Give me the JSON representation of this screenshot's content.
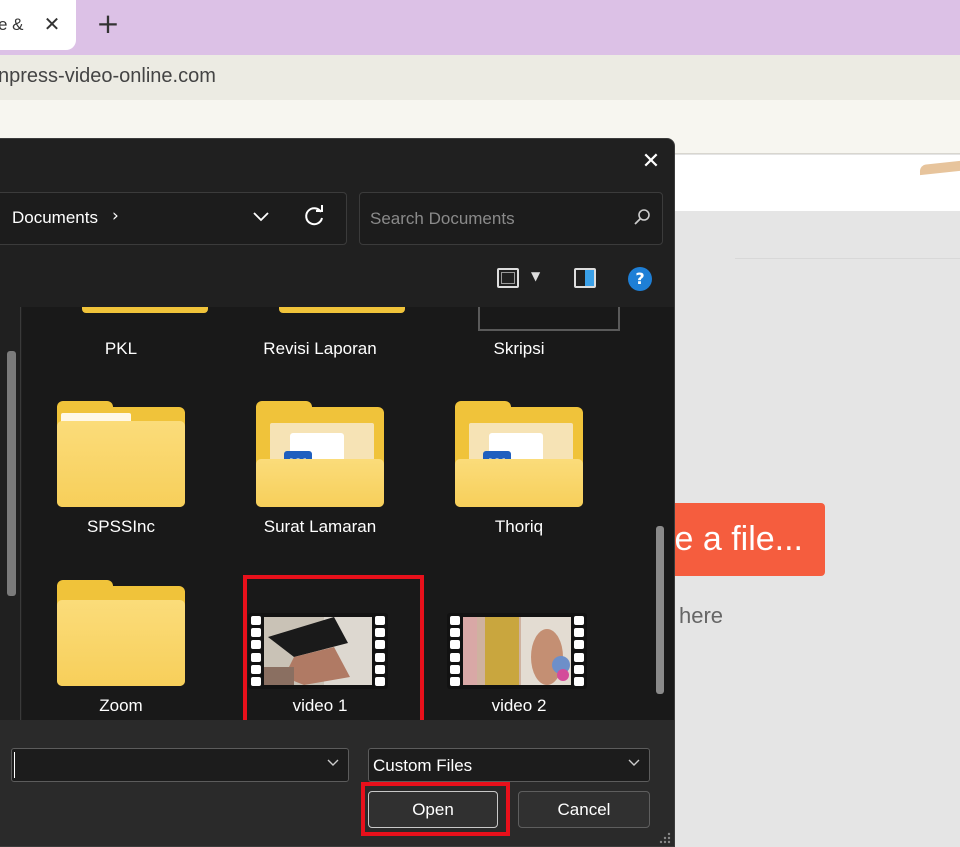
{
  "browser": {
    "tab_title": "e &",
    "tab_close": "✕",
    "new_tab": "+",
    "url": "npress-video-online.com"
  },
  "page": {
    "choose_button": "e a file...",
    "drop_hint": "here"
  },
  "dialog": {
    "close": "✕",
    "breadcrumb": {
      "current": "Documents",
      "separator": "›"
    },
    "search": {
      "placeholder": "Search Documents"
    },
    "toolbar": {
      "help": "?"
    },
    "items": [
      {
        "label": "PKL",
        "type": "folder"
      },
      {
        "label": "Revisi Laporan",
        "type": "folder"
      },
      {
        "label": "Skripsi",
        "type": "folder"
      },
      {
        "label": "SPSSInc",
        "type": "folder"
      },
      {
        "label": "Surat Lamaran",
        "type": "folder-word"
      },
      {
        "label": "Thoriq",
        "type": "folder-word"
      },
      {
        "label": "Zoom",
        "type": "folder"
      },
      {
        "label": "video 1",
        "type": "video",
        "highlighted": true
      },
      {
        "label": "video 2",
        "type": "video"
      }
    ],
    "footer": {
      "filename_value": "",
      "filetype": "Custom Files",
      "open": "Open",
      "cancel": "Cancel"
    }
  },
  "colors": {
    "accent_button": "#f55d3e",
    "highlight_box": "#e8101b",
    "tab_strip": "#dcc1e6",
    "folder": "#f0c33a"
  }
}
